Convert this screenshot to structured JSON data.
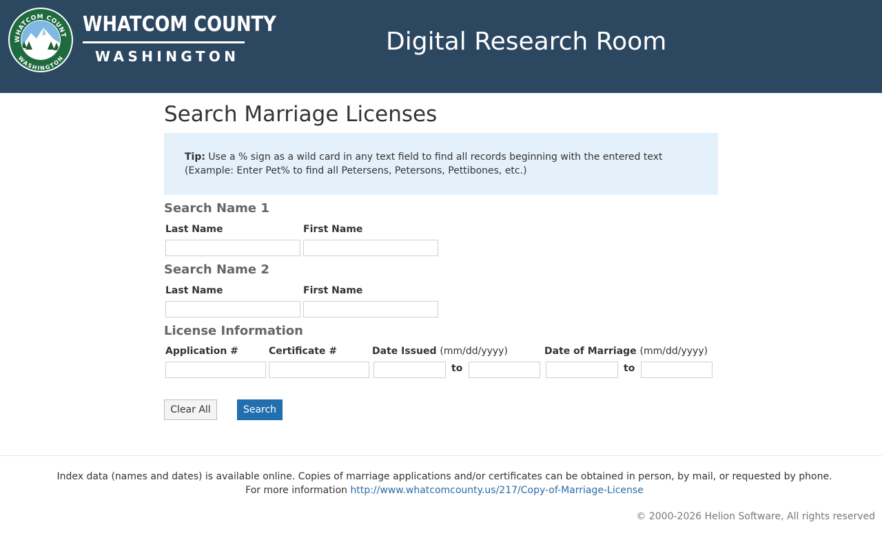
{
  "header": {
    "county_name": "WHATCOM COUNTY",
    "county_state": "WASHINGTON",
    "seal_top_text": "WHATCOM COUNTY",
    "seal_bottom_text": "WASHINGTON",
    "site_title": "Digital Research Room",
    "colors": {
      "banner": "#2c4861",
      "seal_ring": "#1f6b3e"
    }
  },
  "main": {
    "page_title": "Search Marriage Licenses",
    "tip": {
      "label": "Tip:",
      "text": "Use a % sign as a wild card in any text field to find all records beginning with the entered text (Example: Enter Pet% to find all Petersens, Petersons, Pettibones, etc.)"
    },
    "search_name_1": {
      "title": "Search Name 1",
      "last_name_label": "Last Name",
      "first_name_label": "First Name",
      "last_name_value": "",
      "first_name_value": ""
    },
    "search_name_2": {
      "title": "Search Name 2",
      "last_name_label": "Last Name",
      "first_name_label": "First Name",
      "last_name_value": "",
      "first_name_value": ""
    },
    "license_info": {
      "title": "License Information",
      "application_label": "Application #",
      "certificate_label": "Certificate #",
      "date_issued_label": "Date Issued",
      "date_issued_hint": "(mm/dd/yyyy)",
      "date_of_marriage_label": "Date of Marriage",
      "date_of_marriage_hint": "(mm/dd/yyyy)",
      "to_label": "to",
      "application_value": "",
      "certificate_value": "",
      "issued_from_value": "",
      "issued_to_value": "",
      "marriage_from_value": "",
      "marriage_to_value": ""
    },
    "buttons": {
      "clear_all": "Clear All",
      "search": "Search"
    },
    "colors": {
      "tip_background": "#e4f1fa",
      "search_button": "#226fb0"
    }
  },
  "footer": {
    "line1": "Index data (names and dates) is available online. Copies of marriage applications and/or certificates can be obtained in person, by mail, or requested by phone.",
    "line2_prefix": "For more information",
    "link_text": "http://www.whatcomcounty.us/217/Copy-of-Marriage-License",
    "copyright": "© 2000-2026 Helion Software, All rights reserved"
  }
}
